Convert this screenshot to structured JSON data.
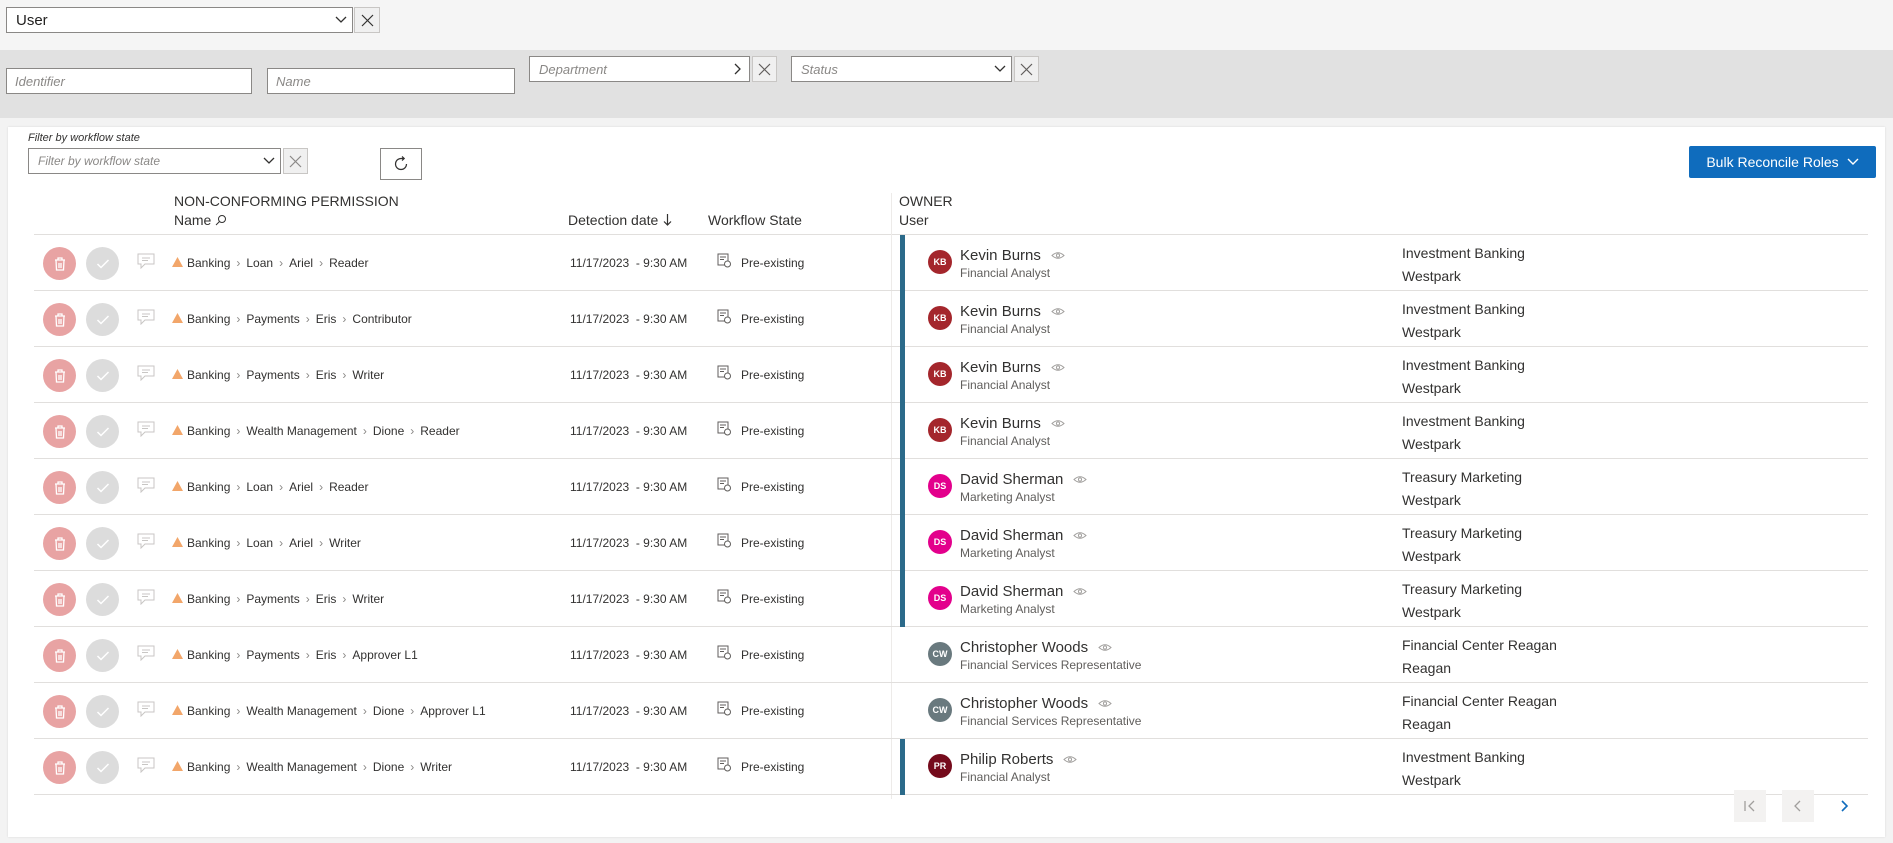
{
  "type_filter": {
    "value": "User"
  },
  "filters": {
    "identifier_placeholder": "Identifier",
    "name_placeholder": "Name",
    "department_placeholder": "Department",
    "status_placeholder": "Status"
  },
  "workflow_filter": {
    "label": "Filter by workflow state",
    "placeholder": "Filter by workflow state"
  },
  "bulk_button": {
    "label": "Bulk Reconcile Roles"
  },
  "headers": {
    "group": "NON-CONFORMING PERMISSION",
    "name": "Name",
    "detection": "Detection date",
    "workflow": "Workflow State",
    "owner_group": "OWNER",
    "owner": "User"
  },
  "rows": [
    {
      "path": [
        "Banking",
        "Loan",
        "Ariel",
        "Reader"
      ],
      "date": "11/17/2023  - 9:30 AM",
      "state": "Pre-existing",
      "initials": "KB",
      "avatar_color": "#a4262c",
      "name": "Kevin Burns",
      "title": "Financial Analyst",
      "dept1": "Investment Banking",
      "dept2": "Westpark",
      "bar": true
    },
    {
      "path": [
        "Banking",
        "Payments",
        "Eris",
        "Contributor"
      ],
      "date": "11/17/2023  - 9:30 AM",
      "state": "Pre-existing",
      "initials": "KB",
      "avatar_color": "#a4262c",
      "name": "Kevin Burns",
      "title": "Financial Analyst",
      "dept1": "Investment Banking",
      "dept2": "Westpark",
      "bar": true
    },
    {
      "path": [
        "Banking",
        "Payments",
        "Eris",
        "Writer"
      ],
      "date": "11/17/2023  - 9:30 AM",
      "state": "Pre-existing",
      "initials": "KB",
      "avatar_color": "#a4262c",
      "name": "Kevin Burns",
      "title": "Financial Analyst",
      "dept1": "Investment Banking",
      "dept2": "Westpark",
      "bar": true
    },
    {
      "path": [
        "Banking",
        "Wealth Management",
        "Dione",
        "Reader"
      ],
      "date": "11/17/2023  - 9:30 AM",
      "state": "Pre-existing",
      "initials": "KB",
      "avatar_color": "#a4262c",
      "name": "Kevin Burns",
      "title": "Financial Analyst",
      "dept1": "Investment Banking",
      "dept2": "Westpark",
      "bar": true
    },
    {
      "path": [
        "Banking",
        "Loan",
        "Ariel",
        "Reader"
      ],
      "date": "11/17/2023  - 9:30 AM",
      "state": "Pre-existing",
      "initials": "DS",
      "avatar_color": "#e3008c",
      "name": "David Sherman",
      "title": "Marketing Analyst",
      "dept1": "Treasury Marketing",
      "dept2": "Westpark",
      "bar": true
    },
    {
      "path": [
        "Banking",
        "Loan",
        "Ariel",
        "Writer"
      ],
      "date": "11/17/2023  - 9:30 AM",
      "state": "Pre-existing",
      "initials": "DS",
      "avatar_color": "#e3008c",
      "name": "David Sherman",
      "title": "Marketing Analyst",
      "dept1": "Treasury Marketing",
      "dept2": "Westpark",
      "bar": true
    },
    {
      "path": [
        "Banking",
        "Payments",
        "Eris",
        "Writer"
      ],
      "date": "11/17/2023  - 9:30 AM",
      "state": "Pre-existing",
      "initials": "DS",
      "avatar_color": "#e3008c",
      "name": "David Sherman",
      "title": "Marketing Analyst",
      "dept1": "Treasury Marketing",
      "dept2": "Westpark",
      "bar": true
    },
    {
      "path": [
        "Banking",
        "Payments",
        "Eris",
        "Approver L1"
      ],
      "date": "11/17/2023  - 9:30 AM",
      "state": "Pre-existing",
      "initials": "CW",
      "avatar_color": "#69797e",
      "name": "Christopher Woods",
      "title": "Financial Services Representative",
      "dept1": "Financial Center Reagan",
      "dept2": "Reagan",
      "bar": false
    },
    {
      "path": [
        "Banking",
        "Wealth Management",
        "Dione",
        "Approver L1"
      ],
      "date": "11/17/2023  - 9:30 AM",
      "state": "Pre-existing",
      "initials": "CW",
      "avatar_color": "#69797e",
      "name": "Christopher Woods",
      "title": "Financial Services Representative",
      "dept1": "Financial Center Reagan",
      "dept2": "Reagan",
      "bar": false
    },
    {
      "path": [
        "Banking",
        "Wealth Management",
        "Dione",
        "Writer"
      ],
      "date": "11/17/2023  - 9:30 AM",
      "state": "Pre-existing",
      "initials": "PR",
      "avatar_color": "#750b1c",
      "name": "Philip Roberts",
      "title": "Financial Analyst",
      "dept1": "Investment Banking",
      "dept2": "Westpark",
      "bar": true
    }
  ],
  "colors": {
    "accent": "#0f6cbd",
    "warning": "#f2a66a",
    "row_bar": "#2b6a8a"
  }
}
